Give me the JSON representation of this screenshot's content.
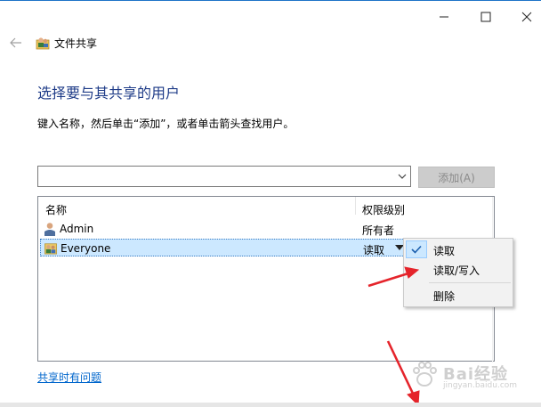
{
  "window": {
    "title": "文件共享"
  },
  "heading": "选择要与其共享的用户",
  "instruction": "键入名称，然后单击“添加”，或者单击箭头查找用户。",
  "name_input": {
    "value": ""
  },
  "add_button": {
    "label": "添加(A)"
  },
  "list": {
    "columns": {
      "name": "名称",
      "permission": "权限级别"
    },
    "rows": [
      {
        "name": "Admin",
        "permission": "所有者",
        "icon": "user-icon"
      },
      {
        "name": "Everyone",
        "permission": "读取",
        "icon": "group-icon",
        "selected": true
      }
    ]
  },
  "context_menu": {
    "items": [
      {
        "label": "读取",
        "checked": true
      },
      {
        "label": "读取/写入",
        "checked": false
      },
      {
        "label": "删除",
        "checked": false
      }
    ]
  },
  "help_link": "共享时有问题",
  "watermark": {
    "brand": "Bai经验",
    "sub": "jingyan.baidu.com"
  },
  "colors": {
    "heading": "#1f3c88",
    "link": "#0066cc",
    "selection": "#cce8ff",
    "annotation_arrow": "#e5242b"
  }
}
